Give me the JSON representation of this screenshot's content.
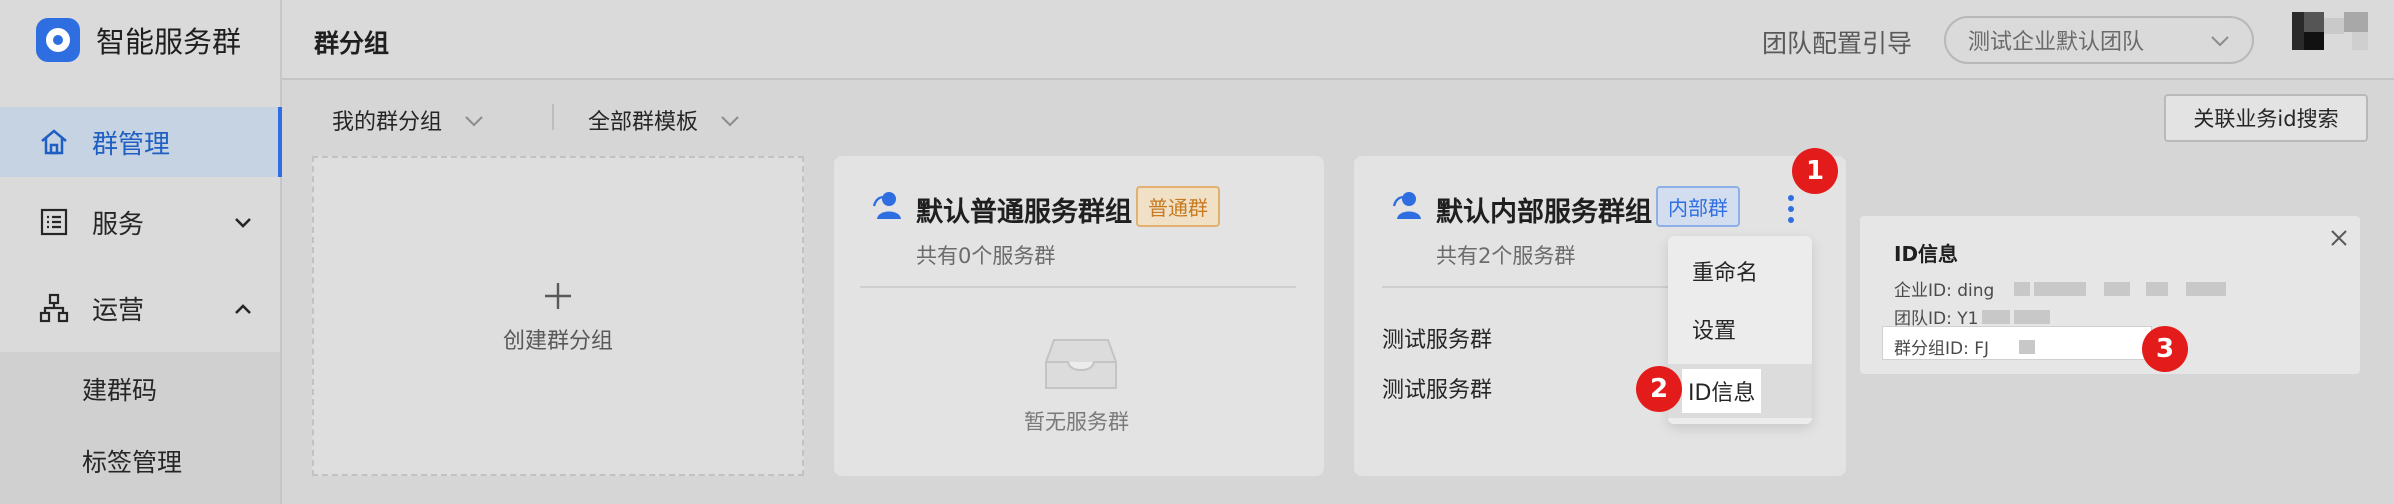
{
  "brand": {
    "name": "智能服务群"
  },
  "sidebar": {
    "items": [
      {
        "label": "群管理",
        "icon": "home-icon"
      },
      {
        "label": "服务",
        "icon": "list-icon"
      },
      {
        "label": "运营",
        "icon": "org-chart-icon"
      }
    ],
    "subitems": [
      {
        "label": "建群码"
      },
      {
        "label": "标签管理"
      }
    ]
  },
  "header": {
    "title": "群分组",
    "guide_link": "团队配置引导",
    "team_select": "测试企业默认团队"
  },
  "filters": {
    "my_groups": "我的群分组",
    "all_templates": "全部群模板",
    "biz_search": "关联业务id搜索"
  },
  "create_card": {
    "label": "创建群分组"
  },
  "cards": [
    {
      "title": "默认普通服务群组",
      "badge": "普通群",
      "count_text": "共有0个服务群",
      "empty_text": "暂无服务群",
      "rows": []
    },
    {
      "title": "默认内部服务群组",
      "badge": "内部群",
      "count_text": "共有2个服务群",
      "rows": [
        "测试服务群",
        "测试服务群"
      ]
    }
  ],
  "menu": {
    "items": [
      "重命名",
      "设置",
      "ID信息"
    ]
  },
  "id_panel": {
    "title": "ID信息",
    "corp_id_label": "企业ID: ding",
    "team_id_label": "团队ID: Y1",
    "group_id_label": "群分组ID: FJ"
  },
  "steps": [
    "1",
    "2",
    "3"
  ],
  "colors": {
    "accent": "#2f6ee0",
    "marker": "#e41b1b",
    "badge_orange": "#c77a1f",
    "badge_blue": "#2f6ee0"
  }
}
